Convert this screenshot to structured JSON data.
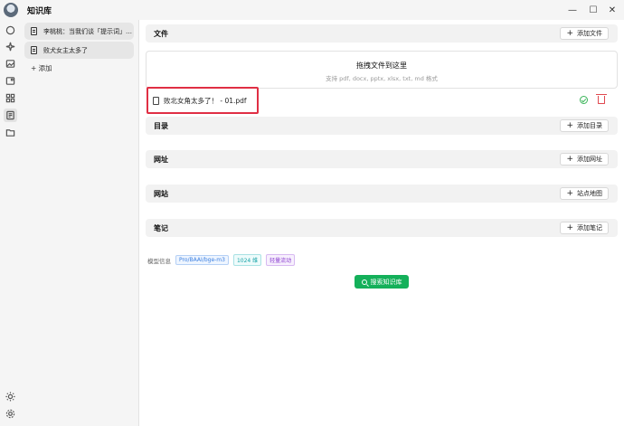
{
  "app": {
    "title": "知识库"
  },
  "window_controls": {
    "minimize": "—",
    "maximize": "☐",
    "close": "✕"
  },
  "rail": {
    "icons": [
      "chat-icon",
      "sparkle-icon",
      "image-icon",
      "photo-icon",
      "apps-icon",
      "knowledge-icon",
      "folder-icon"
    ],
    "bottom_icons": [
      "sun-icon",
      "settings-icon"
    ]
  },
  "knowledge_bases": {
    "items": [
      {
        "label": "李桃桃：当我们谈「提示词」时..."
      },
      {
        "label": "败犬女主太多了"
      }
    ],
    "add_label": "+ 添加"
  },
  "sections": {
    "files": {
      "title": "文件",
      "button": "添加文件"
    },
    "directory": {
      "title": "目录",
      "button": "添加目录"
    },
    "urls": {
      "title": "网址",
      "button": "添加网址"
    },
    "websites": {
      "title": "网站",
      "button": "站点地图"
    },
    "notes": {
      "title": "笔记",
      "button": "添加笔记"
    }
  },
  "dropzone": {
    "title": "拖拽文件到这里",
    "hint": "支持 pdf, docx, pptx, xlsx, txt, md 格式"
  },
  "files": [
    {
      "name": "败北女角太多了！ - 01.pdf",
      "status": "completed"
    }
  ],
  "model_info": {
    "label": "模型信息",
    "model": "Pro/BAAI/bge-m3",
    "dimensions": "1024 维",
    "mode": "轻量流动"
  },
  "search_button": "搜索知识库",
  "colors": {
    "accent_green": "#14b05a",
    "highlight_red": "#e02f44",
    "delete_red": "#e0484f"
  }
}
